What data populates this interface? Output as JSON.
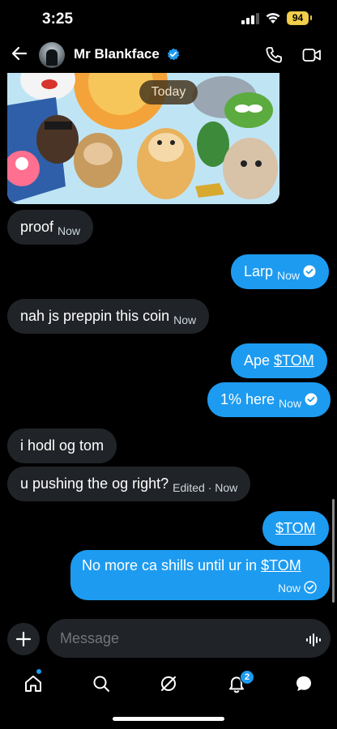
{
  "status_bar": {
    "time": "3:25",
    "battery": "94"
  },
  "header": {
    "contact_name": "Mr Blankface"
  },
  "chat": {
    "date_divider": "Today",
    "messages": [
      {
        "direction": "incoming",
        "text": "proof",
        "meta": "Now"
      },
      {
        "direction": "outgoing",
        "text": "Larp",
        "meta": "Now"
      },
      {
        "direction": "incoming",
        "text": "nah js preppin this coin",
        "meta": "Now"
      },
      {
        "direction": "outgoing",
        "text_prefix": "Ape ",
        "token": "$TOM"
      },
      {
        "direction": "outgoing",
        "text": "1% here",
        "meta": "Now"
      },
      {
        "direction": "incoming",
        "text": "i hodl og tom"
      },
      {
        "direction": "incoming",
        "text": "u pushing the og right?",
        "meta": "Edited · Now"
      },
      {
        "direction": "outgoing",
        "token": "$TOM"
      },
      {
        "direction": "outgoing",
        "text_prefix": "No more ca shills until ur in ",
        "token": "$TOM",
        "meta": "Now"
      }
    ]
  },
  "composer": {
    "placeholder": "Message"
  },
  "tab_bar": {
    "notifications_count": "2"
  },
  "colors": {
    "accent": "#1d9bf0",
    "incoming_bubble": "#202327",
    "background": "#000000"
  }
}
